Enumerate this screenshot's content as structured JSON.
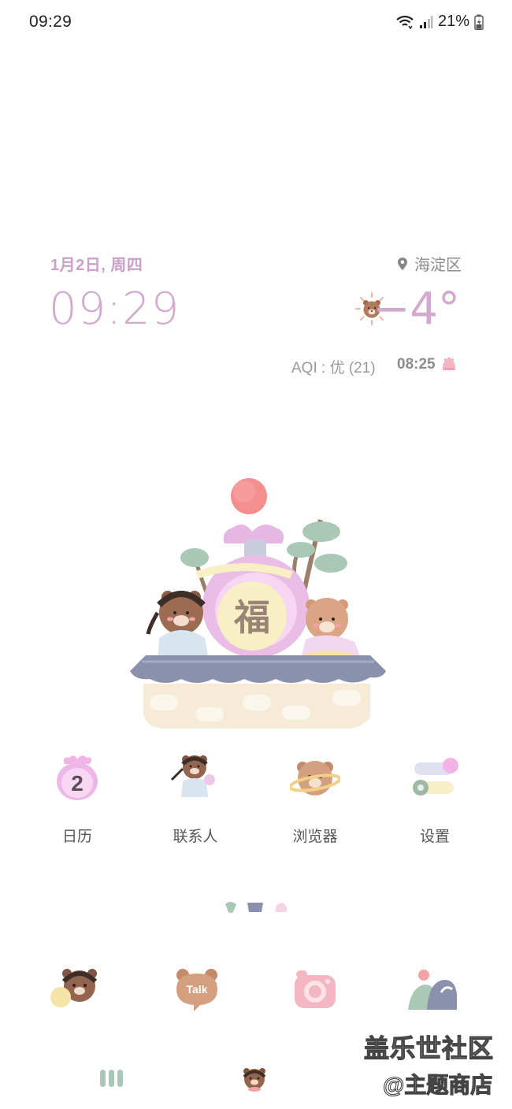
{
  "status_bar": {
    "time": "09:29",
    "battery": "21%",
    "icons": [
      "wifi-icon",
      "signal-icon",
      "battery-charging-icon"
    ]
  },
  "widget": {
    "date": "1月2日, 周四",
    "time": "09:29",
    "location": "海淀区",
    "temperature": "−4°",
    "aqi": "AQI : 优 (21)",
    "sunrise": "08:25",
    "accent_color": "#d2a9cf"
  },
  "illustration": {
    "label": "福"
  },
  "apps": [
    {
      "label": "日历",
      "icon": "calendar-icon",
      "badge": "2"
    },
    {
      "label": "联系人",
      "icon": "contacts-icon"
    },
    {
      "label": "浏览器",
      "icon": "browser-icon"
    },
    {
      "label": "设置",
      "icon": "settings-icon"
    }
  ],
  "dock": [
    {
      "icon": "bear-app-icon"
    },
    {
      "icon": "talk-icon",
      "text": "Talk"
    },
    {
      "icon": "camera-icon"
    },
    {
      "icon": "gallery-icon"
    }
  ],
  "nav_bar": {
    "icons": [
      "recent-apps-icon",
      "home-bear-icon"
    ]
  },
  "watermark": {
    "line1": "盖乐世社区",
    "line2": "@主题商店"
  }
}
